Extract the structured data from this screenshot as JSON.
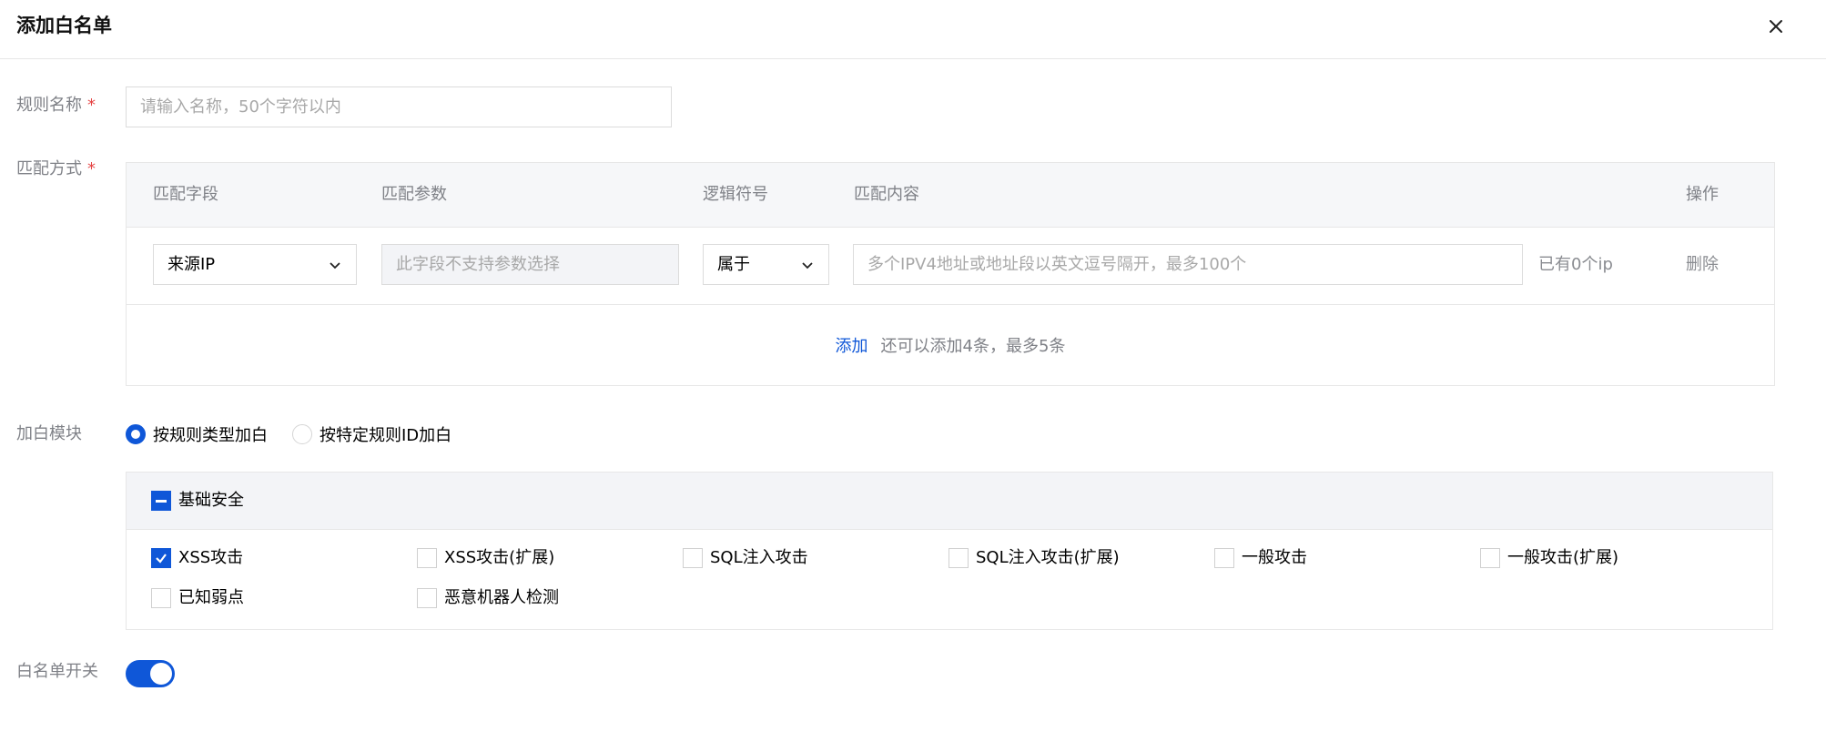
{
  "dialog": {
    "title": "添加白名单",
    "close_icon": "close-icon"
  },
  "rule_name": {
    "label": "规则名称",
    "required_mark": "*",
    "placeholder": "请输入名称，50个字符以内",
    "value": ""
  },
  "match": {
    "label": "匹配方式",
    "required_mark": "*",
    "columns": {
      "field": "匹配字段",
      "param": "匹配参数",
      "logic": "逻辑符号",
      "content": "匹配内容",
      "action": "操作"
    },
    "rows": [
      {
        "field": "来源IP",
        "param_placeholder": "此字段不支持参数选择",
        "logic": "属于",
        "content_placeholder": "多个IPV4地址或地址段以英文逗号隔开，最多100个",
        "count": "已有0个ip",
        "action": "删除"
      }
    ],
    "add_link": "添加",
    "add_hint": "还可以添加4条，最多5条"
  },
  "module": {
    "label": "加白模块",
    "options": [
      {
        "label": "按规则类型加白",
        "selected": true
      },
      {
        "label": "按特定规则ID加白",
        "selected": false
      }
    ],
    "group": {
      "label": "基础安全",
      "state": "indeterminate",
      "items": [
        {
          "label": "XSS攻击",
          "checked": true
        },
        {
          "label": "XSS攻击(扩展)",
          "checked": false
        },
        {
          "label": "SQL注入攻击",
          "checked": false
        },
        {
          "label": "SQL注入攻击(扩展)",
          "checked": false
        },
        {
          "label": "一般攻击",
          "checked": false
        },
        {
          "label": "一般攻击(扩展)",
          "checked": false
        },
        {
          "label": "已知弱点",
          "checked": false
        },
        {
          "label": "恶意机器人检测",
          "checked": false
        }
      ]
    }
  },
  "whitelist_switch": {
    "label": "白名单开关",
    "on": true
  },
  "colors": {
    "accent": "#0f57d8",
    "required": "#e54545",
    "muted_text": "#7f8187",
    "border": "#e7e7e7"
  }
}
